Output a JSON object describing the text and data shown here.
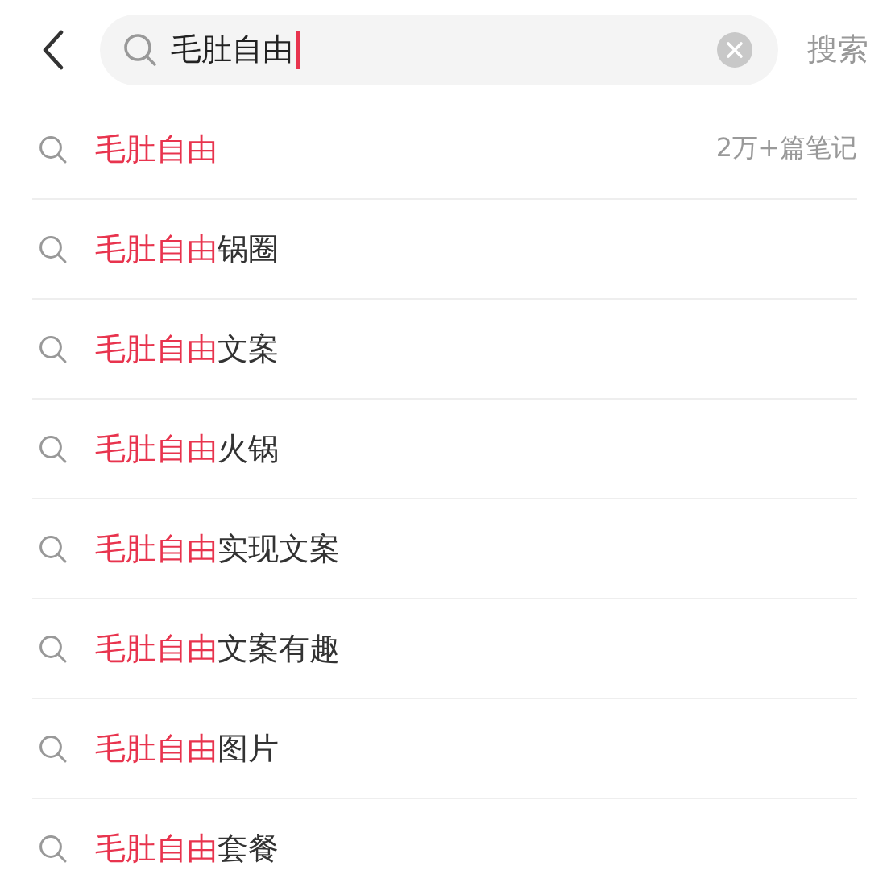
{
  "search": {
    "value": "毛肚自由",
    "button": "搜索"
  },
  "suggestions": [
    {
      "match": "毛肚自由",
      "count": "2万+篇笔记"
    },
    {
      "match": "毛肚自由",
      "rest": "锅圈"
    },
    {
      "match": "毛肚自由",
      "rest": "文案"
    },
    {
      "match": "毛肚自由",
      "rest": "火锅"
    },
    {
      "match": "毛肚自由",
      "rest": "实现文案"
    },
    {
      "match": "毛肚自由",
      "rest": "文案有趣"
    },
    {
      "match": "毛肚自由",
      "rest": "图片"
    },
    {
      "match": "毛肚自由",
      "rest": "套餐"
    }
  ]
}
